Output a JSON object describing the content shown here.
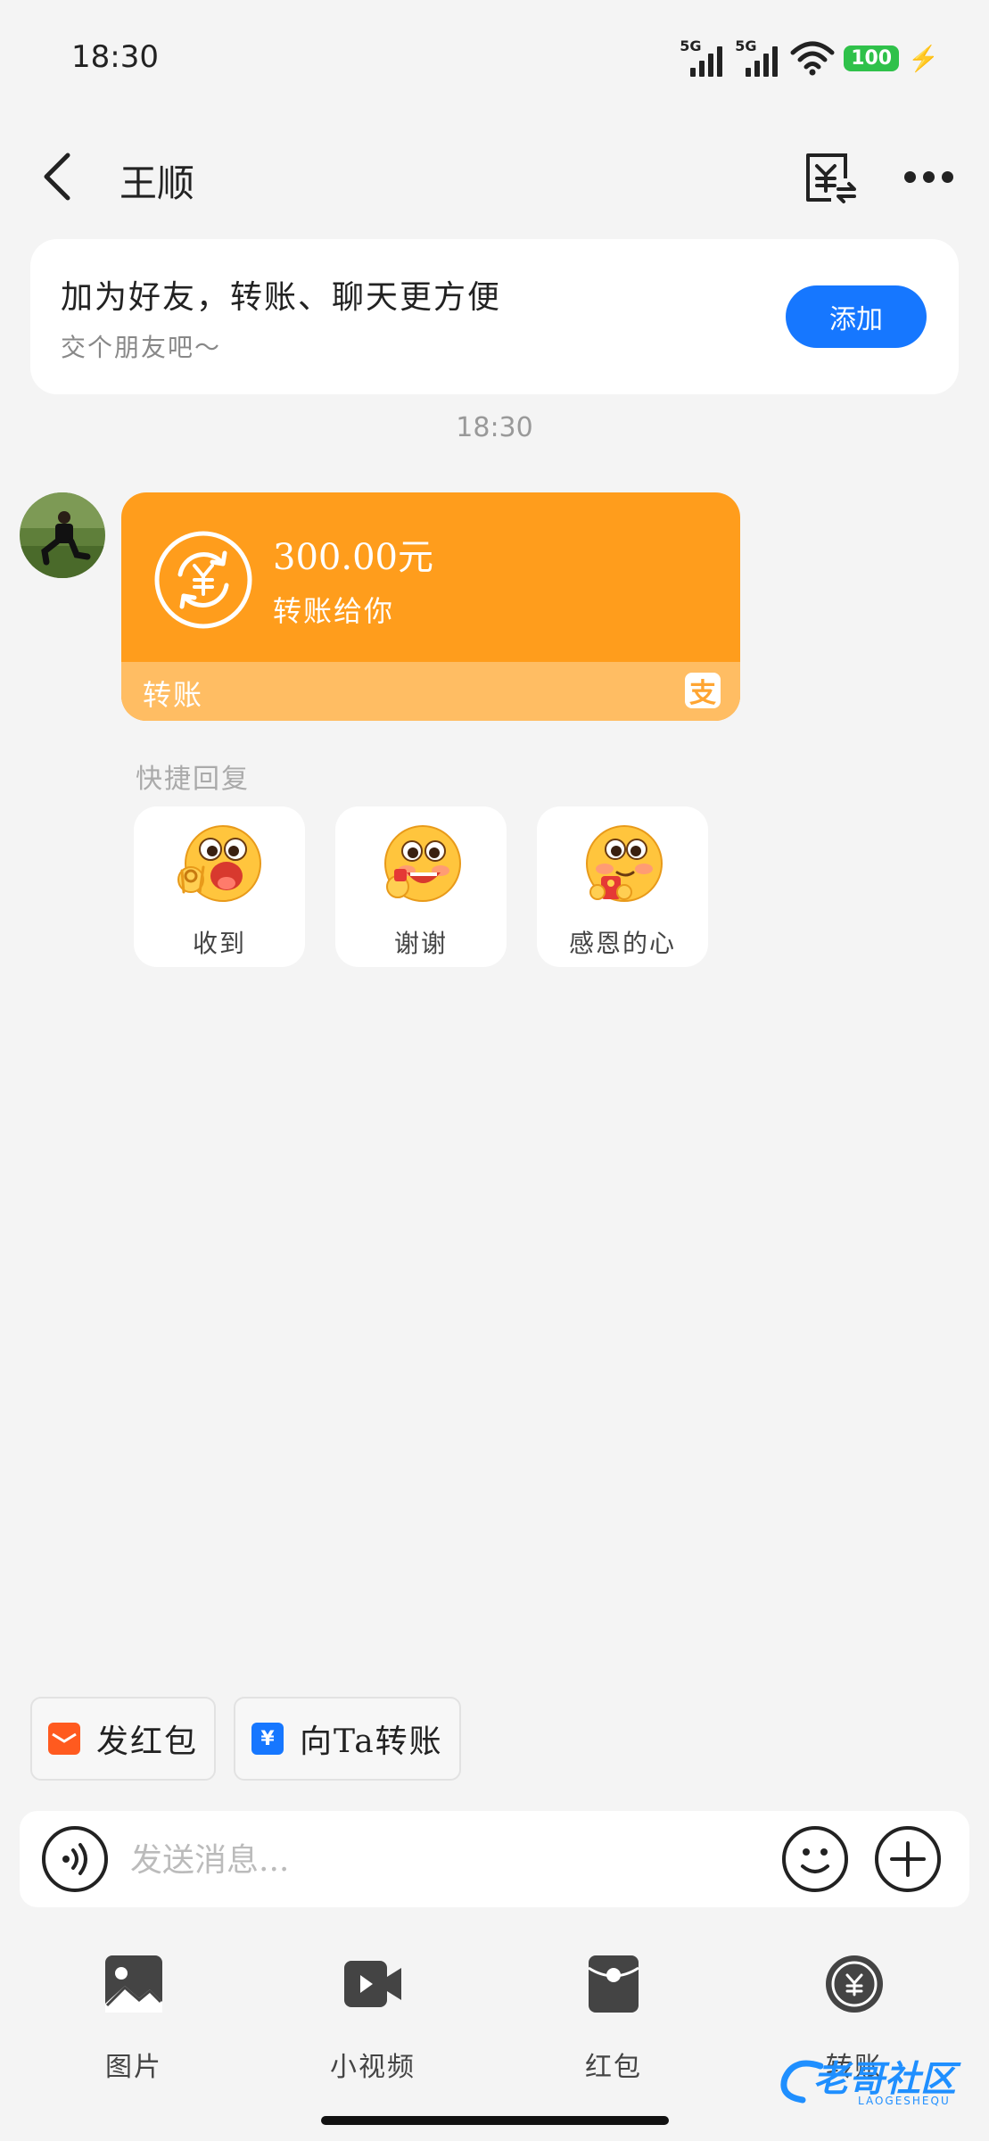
{
  "status_bar": {
    "time": "18:30",
    "sim1_label": "5G",
    "sim2_label": "5G",
    "battery": "100",
    "icons": [
      "signal-icon",
      "signal-icon",
      "wifi-icon",
      "battery-icon",
      "charging-icon"
    ]
  },
  "header": {
    "title": "王顺",
    "icons": [
      "back-icon",
      "bill-icon",
      "more-icon"
    ]
  },
  "friend_card": {
    "title": "加为好友，转账、聊天更方便",
    "subtitle": "交个朋友吧～",
    "button": "添加"
  },
  "chat": {
    "time": "18:30",
    "transfer": {
      "amount": "300.00元",
      "description": "转账给你",
      "label": "转账",
      "badge_char": "支",
      "color": "#ff9d1c",
      "footer_color": "#ffbd63"
    },
    "quick_reply_title": "快捷回复",
    "quick_replies": [
      {
        "label": "收到",
        "icon": "ok-hand-emoji-icon"
      },
      {
        "label": "谢谢",
        "icon": "thanks-emoji-icon"
      },
      {
        "label": "感恩的心",
        "icon": "grateful-emoji-icon"
      }
    ]
  },
  "shortcuts": [
    {
      "label": "发红包",
      "icon": "red-envelope-icon",
      "color": "#ff5a1f",
      "glyph": ""
    },
    {
      "label": "向Ta转账",
      "icon": "transfer-icon",
      "color": "#1677ff",
      "glyph": "¥"
    }
  ],
  "input": {
    "placeholder": "发送消息...",
    "icons": [
      "voice-icon",
      "emoji-icon",
      "plus-icon"
    ]
  },
  "tools": [
    {
      "label": "图片",
      "icon": "image-icon"
    },
    {
      "label": "小视频",
      "icon": "video-icon"
    },
    {
      "label": "红包",
      "icon": "red-packet-icon"
    },
    {
      "label": "转账",
      "icon": "transfer-circle-icon"
    }
  ],
  "watermark": {
    "text": "老哥社区",
    "sub": "LAOGESHEQU"
  },
  "colors": {
    "accent": "#1677ff",
    "background": "#f4f4f4",
    "battery": "#2fc14a"
  }
}
